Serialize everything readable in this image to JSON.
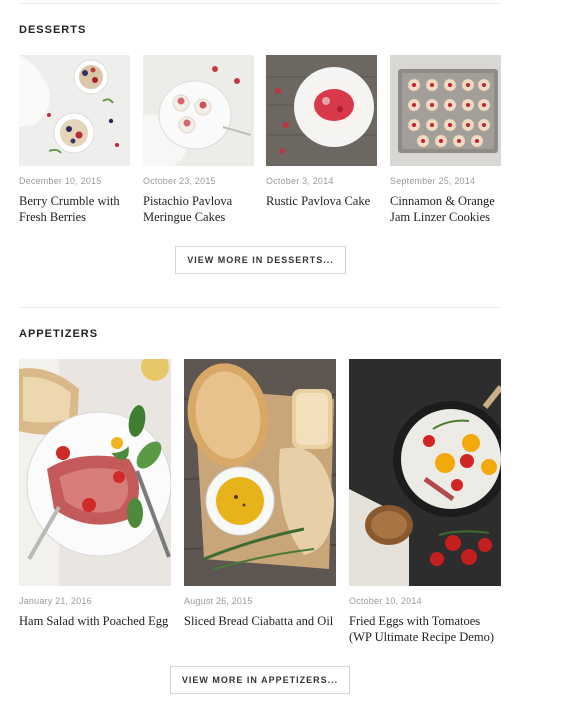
{
  "sections": [
    {
      "title": "DESSERTS",
      "more_label": "VIEW MORE IN DESSERTS...",
      "posts": [
        {
          "date": "December 10, 2015",
          "title": "Berry Crumble with Fresh Berries"
        },
        {
          "date": "October 23, 2015",
          "title": "Pistachio Pavlova Meringue Cakes"
        },
        {
          "date": "October 3, 2014",
          "title": "Rustic Pavlova Cake"
        },
        {
          "date": "September 25, 2014",
          "title": "Cinnamon & Orange Jam Linzer Cookies"
        }
      ]
    },
    {
      "title": "APPETIZERS",
      "more_label": "VIEW MORE IN APPETIZERS...",
      "posts": [
        {
          "date": "January 21, 2016",
          "title": "Ham Salad with Poached Egg"
        },
        {
          "date": "August 26, 2015",
          "title": "Sliced Bread Ciabatta and Oil"
        },
        {
          "date": "October 10, 2014",
          "title": "Fried Eggs with Tomatoes (WP Ultimate Recipe Demo)"
        }
      ]
    }
  ]
}
